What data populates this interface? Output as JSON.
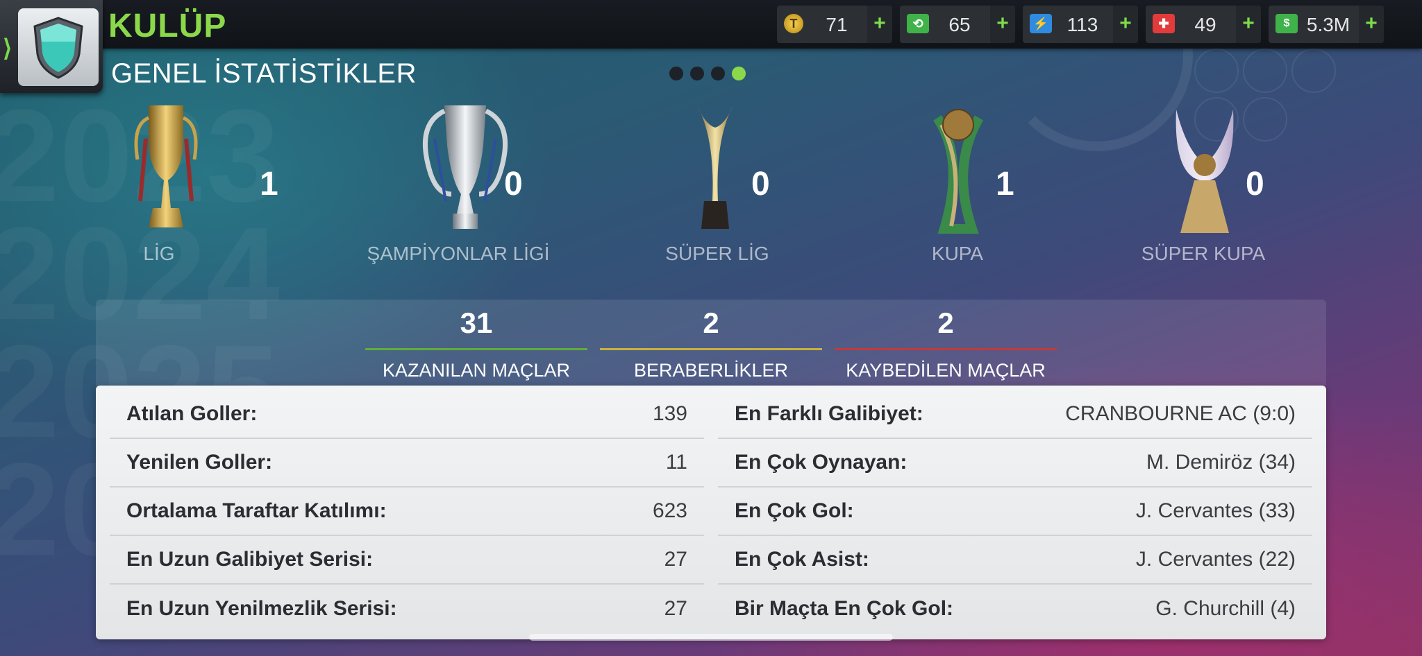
{
  "header": {
    "club_title": "KULÜP",
    "page_title": "GENEL İSTATİSTİKLER",
    "logo_icon": "club-shield-icon"
  },
  "currencies": [
    {
      "icon": "token-coin-icon",
      "value": "71",
      "color": "#e0b22a"
    },
    {
      "icon": "training-cash-icon",
      "value": "65",
      "color": "#3fb34a"
    },
    {
      "icon": "energy-icon",
      "value": "113",
      "color": "#2e8be0"
    },
    {
      "icon": "medical-icon",
      "value": "49",
      "color": "#e33b3b"
    },
    {
      "icon": "money-icon",
      "value": "5.3M",
      "color": "#3fb34a"
    }
  ],
  "pager": {
    "count": 4,
    "active_index": 3
  },
  "trophies": [
    {
      "label": "LİG",
      "count": "1"
    },
    {
      "label": "ŞAMPİYONLAR LİGİ",
      "count": "0"
    },
    {
      "label": "SÜPER LİG",
      "count": "0"
    },
    {
      "label": "KUPA",
      "count": "1"
    },
    {
      "label": "SÜPER KUPA",
      "count": "0"
    }
  ],
  "summary": [
    {
      "value": "31",
      "label": "KAZANILAN MAÇLAR",
      "color": "#5fae3a"
    },
    {
      "value": "2",
      "label": "BERABERLİKLER",
      "color": "#c8b23a"
    },
    {
      "value": "2",
      "label": "KAYBEDİLEN MAÇLAR",
      "color": "#c23a3a"
    }
  ],
  "stats_left": [
    {
      "label": "Atılan Goller:",
      "value": "139"
    },
    {
      "label": "Yenilen Goller:",
      "value": "11"
    },
    {
      "label": "Ortalama Taraftar Katılımı:",
      "value": "623"
    },
    {
      "label": "En Uzun Galibiyet Serisi:",
      "value": "27"
    },
    {
      "label": "En Uzun Yenilmezlik Serisi:",
      "value": "27"
    }
  ],
  "stats_right": [
    {
      "label": "En Farklı Galibiyet:",
      "value": "CRANBOURNE AC (9:0)"
    },
    {
      "label": "En Çok Oynayan:",
      "value": "M. Demiröz (34)"
    },
    {
      "label": "En Çok Gol:",
      "value": "J. Cervantes (33)"
    },
    {
      "label": "En Çok Asist:",
      "value": "J. Cervantes (22)"
    },
    {
      "label": "Bir Maçta En Çok Gol:",
      "value": "G. Churchill (4)"
    }
  ]
}
